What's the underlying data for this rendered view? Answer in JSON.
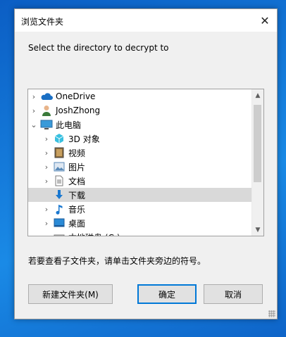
{
  "window": {
    "title": "浏览文件夹",
    "close_glyph": "✕"
  },
  "prompt": "Select the directory to decrypt to",
  "tree": {
    "items": [
      {
        "label": "OneDrive",
        "icon": "onedrive-cloud-icon",
        "expander": "›",
        "color": "#1a6fc4"
      },
      {
        "label": "JoshZhong",
        "icon": "user-icon",
        "expander": "›",
        "color": "#3a7a3a"
      },
      {
        "label": "此电脑",
        "icon": "this-pc-icon",
        "expander": "⌄",
        "color": "#3a9ad9"
      },
      {
        "label": "3D 对象",
        "icon": "3d-objects-icon",
        "expander": "›",
        "color": "#39c0e0"
      },
      {
        "label": "视频",
        "icon": "videos-icon",
        "expander": "›",
        "color": "#444444"
      },
      {
        "label": "图片",
        "icon": "pictures-icon",
        "expander": "›",
        "color": "#5a8ab8"
      },
      {
        "label": "文档",
        "icon": "documents-icon",
        "expander": "›",
        "color": "#7a7a7a"
      },
      {
        "label": "下载",
        "icon": "downloads-icon",
        "expander": "",
        "color": "#1a78d0"
      },
      {
        "label": "音乐",
        "icon": "music-icon",
        "expander": "›",
        "color": "#1a78d0"
      },
      {
        "label": "桌面",
        "icon": "desktop-icon",
        "expander": "›",
        "color": "#2a8ad6"
      },
      {
        "label": "本地磁盘 (C:)",
        "icon": "local-disk-icon",
        "expander": "›",
        "color": "#777777"
      }
    ],
    "selected_index": 7
  },
  "hint": "若要查看子文件夹，请单击文件夹旁边的符号。",
  "buttons": {
    "new_folder": "新建文件夹(M)",
    "ok": "确定",
    "cancel": "取消"
  }
}
